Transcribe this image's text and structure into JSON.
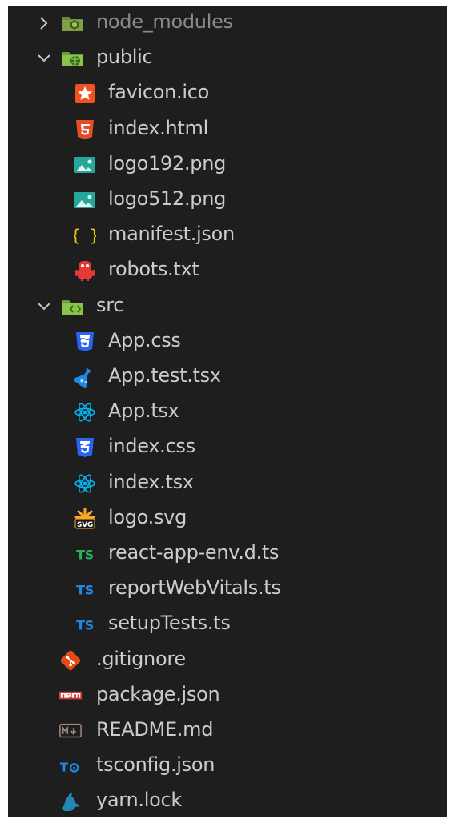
{
  "colors": {
    "background": "#1e1e1e",
    "text": "#cccccc",
    "dimmed_text": "#8b8b8b",
    "folder_green": "#8bc34a",
    "html_orange": "#e44d26",
    "css_blue": "#2965f1",
    "react_blue": "#00b4f0",
    "ts_green": "#4caf50",
    "ts_blue": "#0288d1",
    "json_yellow": "#f1c40f",
    "git_orange": "#e64a19",
    "npm_red": "#cb3837"
  },
  "tree": [
    {
      "label": "node_modules",
      "kind": "folder",
      "expanded": false,
      "depth": 0,
      "icon": "folder-node-icon",
      "dimmed": true
    },
    {
      "label": "public",
      "kind": "folder",
      "expanded": true,
      "depth": 0,
      "icon": "folder-public-icon"
    },
    {
      "label": "favicon.ico",
      "kind": "file",
      "depth": 1,
      "icon": "favicon-icon"
    },
    {
      "label": "index.html",
      "kind": "file",
      "depth": 1,
      "icon": "html5-icon"
    },
    {
      "label": "logo192.png",
      "kind": "file",
      "depth": 1,
      "icon": "image-icon"
    },
    {
      "label": "logo512.png",
      "kind": "file",
      "depth": 1,
      "icon": "image-icon"
    },
    {
      "label": "manifest.json",
      "kind": "file",
      "depth": 1,
      "icon": "json-braces-icon"
    },
    {
      "label": "robots.txt",
      "kind": "file",
      "depth": 1,
      "icon": "robot-icon"
    },
    {
      "label": "src",
      "kind": "folder",
      "expanded": true,
      "depth": 0,
      "icon": "folder-src-icon"
    },
    {
      "label": "App.css",
      "kind": "file",
      "depth": 1,
      "icon": "css3-icon"
    },
    {
      "label": "App.test.tsx",
      "kind": "file",
      "depth": 1,
      "icon": "test-flask-icon"
    },
    {
      "label": "App.tsx",
      "kind": "file",
      "depth": 1,
      "icon": "react-icon"
    },
    {
      "label": "index.css",
      "kind": "file",
      "depth": 1,
      "icon": "css3-icon"
    },
    {
      "label": "index.tsx",
      "kind": "file",
      "depth": 1,
      "icon": "react-icon"
    },
    {
      "label": "logo.svg",
      "kind": "file",
      "depth": 1,
      "icon": "svg-icon"
    },
    {
      "label": "react-app-env.d.ts",
      "kind": "file",
      "depth": 1,
      "icon": "ts-definition-icon"
    },
    {
      "label": "reportWebVitals.ts",
      "kind": "file",
      "depth": 1,
      "icon": "typescript-icon"
    },
    {
      "label": "setupTests.ts",
      "kind": "file",
      "depth": 1,
      "icon": "typescript-icon"
    },
    {
      "label": ".gitignore",
      "kind": "file",
      "depth": 0,
      "icon": "git-icon"
    },
    {
      "label": "package.json",
      "kind": "file",
      "depth": 0,
      "icon": "npm-icon"
    },
    {
      "label": "README.md",
      "kind": "file",
      "depth": 0,
      "icon": "markdown-icon"
    },
    {
      "label": "tsconfig.json",
      "kind": "file",
      "depth": 0,
      "icon": "tsconfig-icon"
    },
    {
      "label": "yarn.lock",
      "kind": "file",
      "depth": 0,
      "icon": "yarn-icon"
    }
  ]
}
